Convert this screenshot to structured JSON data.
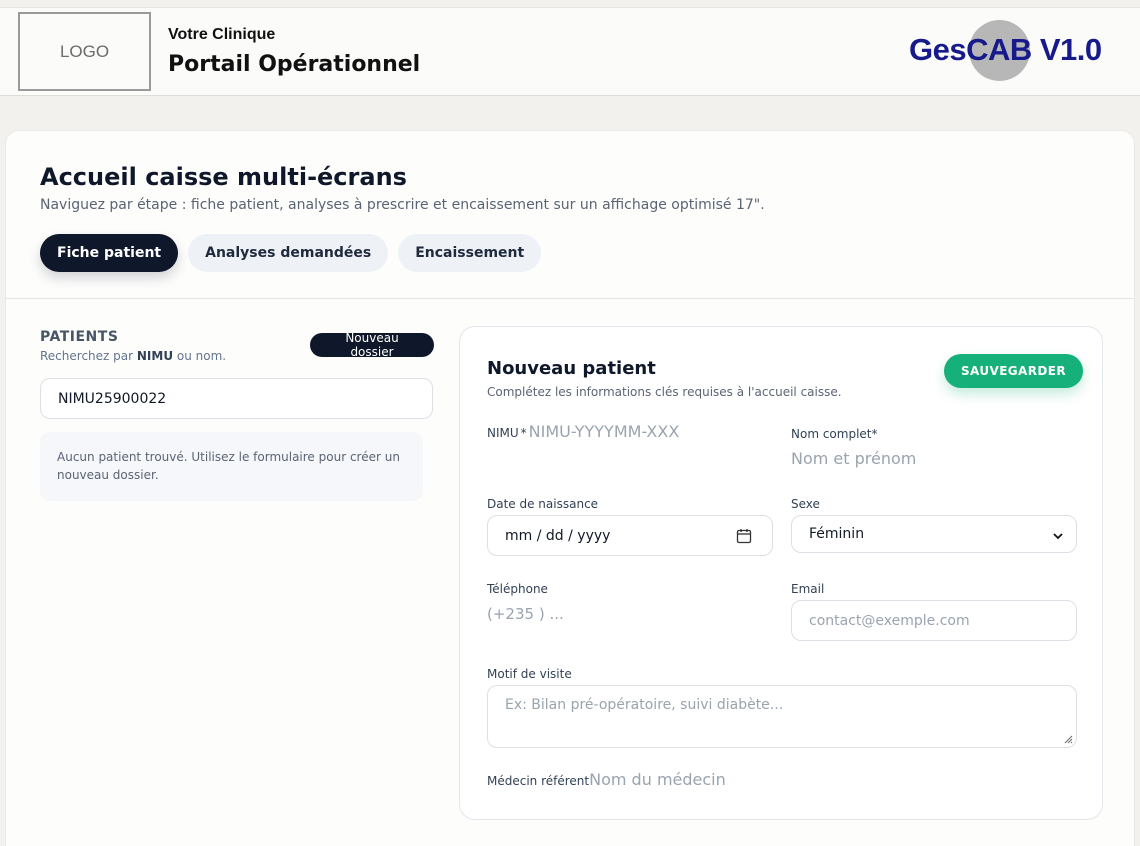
{
  "header": {
    "logo_text": "LOGO",
    "clinic": "Votre Clinique",
    "portal": "Portail Opérationnel",
    "brand": "GesCAB V1.0"
  },
  "page": {
    "title": "Accueil caisse multi-écrans",
    "subtitle": "Naviguez par étape : fiche patient, analyses à prescrire et encaissement sur un affichage optimisé 17\".",
    "tabs": [
      {
        "label": "Fiche patient",
        "active": true
      },
      {
        "label": "Analyses demandées",
        "active": false
      },
      {
        "label": "Encaissement",
        "active": false
      }
    ]
  },
  "patients": {
    "title": "PATIENTS",
    "subtitle_prefix": "Recherchez par",
    "subtitle_code": "NIMU",
    "subtitle_suffix": "ou nom.",
    "new_button": "Nouveau dossier",
    "search_value": "NIMU25900022",
    "empty_message": "Aucun patient trouvé. Utilisez le formulaire pour créer un nouveau dossier."
  },
  "form": {
    "title": "Nouveau patient",
    "subtitle": "Complétez les informations clés requises à l'accueil caisse.",
    "save_button": "SAUVEGARDER",
    "nimu_label": "NIMU",
    "nimu_star": "*",
    "nimu_placeholder": "NIMU-YYYYMM-XXX",
    "fullname_label": "Nom complet*",
    "fullname_placeholder": "Nom et prénom",
    "dob_label": "Date de naissance",
    "dob_placeholder": "mm / dd / yyyy",
    "sex_label": "Sexe",
    "sex_value": "Féminin",
    "phone_label": "Téléphone",
    "phone_placeholder": "(+235 ) ...",
    "email_label": "Email",
    "email_placeholder": "contact@exemple.com",
    "motif_label": "Motif de visite",
    "motif_placeholder": "Ex: Bilan pré-opératoire, suivi diabète...",
    "doctor_label": "Médecin référent",
    "doctor_placeholder": "Nom du médecin"
  },
  "colors": {
    "primary_dark": "#0f172a",
    "success": "#16b07a",
    "brand_blue": "#161a8a"
  }
}
